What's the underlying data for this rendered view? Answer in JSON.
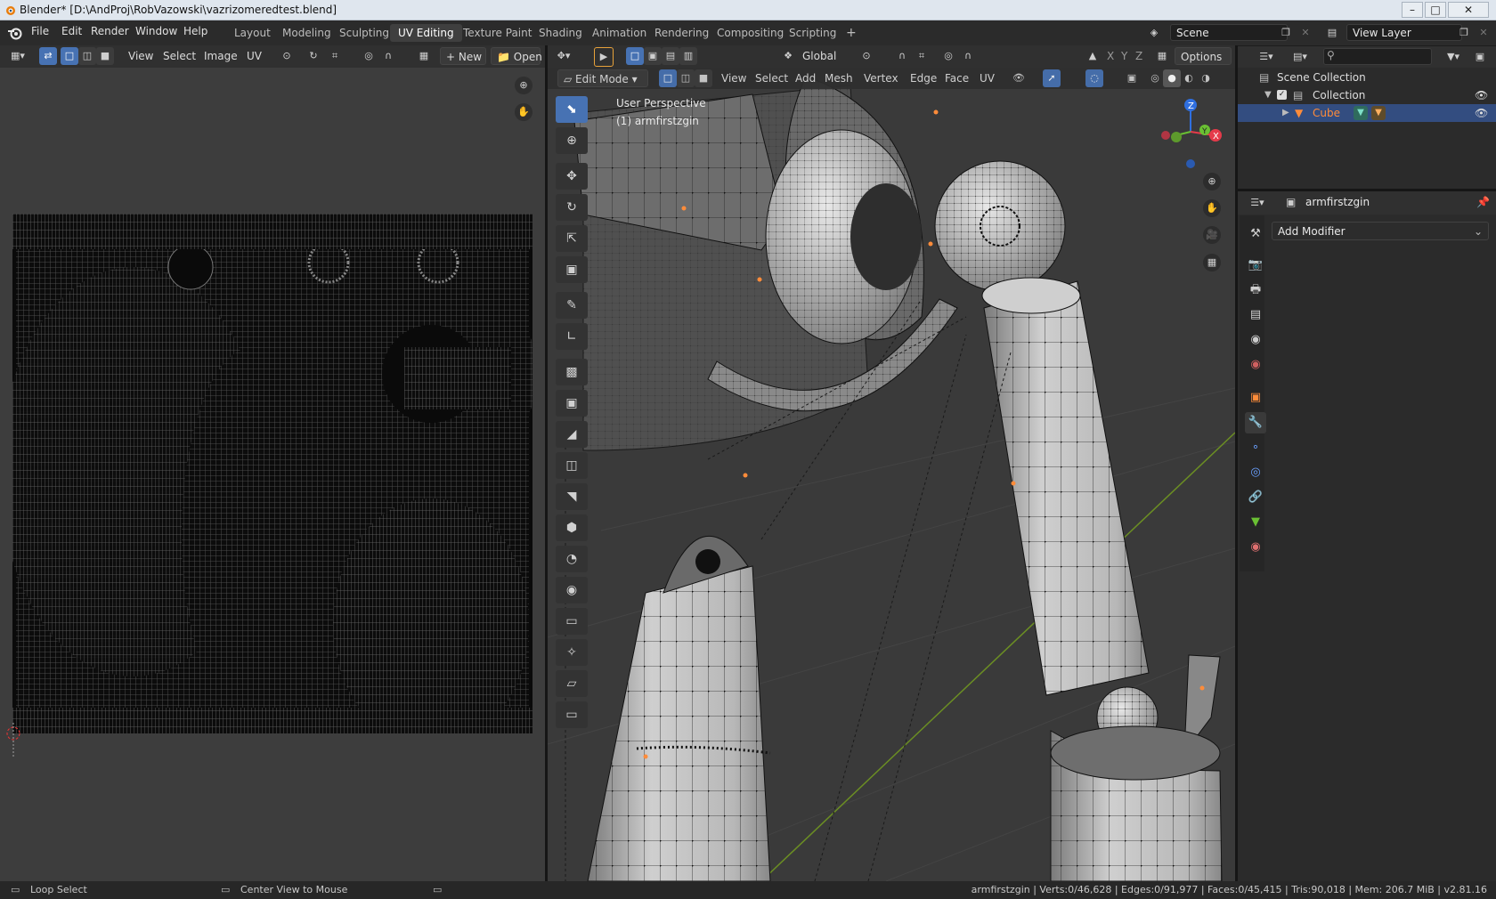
{
  "window": {
    "title": "Blender* [D:\\AndProj\\RobVazowski\\vazrizomeredtest.blend]",
    "controls": [
      "–",
      "□",
      "✕"
    ]
  },
  "topbar": {
    "menus": [
      "File",
      "Edit",
      "Render",
      "Window",
      "Help"
    ],
    "workspaces": [
      "Layout",
      "Modeling",
      "Sculpting",
      "UV Editing",
      "Texture Paint",
      "Shading",
      "Animation",
      "Rendering",
      "Compositing",
      "Scripting"
    ],
    "active_workspace": "UV Editing",
    "add_workspace": "+",
    "scene": "Scene",
    "view_layer": "View Layer"
  },
  "uv_editor": {
    "menus": [
      "View",
      "Select",
      "Image",
      "UV"
    ],
    "new_label": "New",
    "open_label": "Open"
  },
  "viewport": {
    "transform_orientation": "Global",
    "options_label": "Options",
    "mode": "Edit Mode",
    "menus": [
      "View",
      "Select",
      "Add",
      "Mesh",
      "Vertex",
      "Edge",
      "Face",
      "UV"
    ],
    "overlay_title": "User Perspective",
    "overlay_object": "(1) armfirstzgin",
    "gizmo_axes": [
      "X",
      "Y",
      "Z"
    ]
  },
  "outliner": {
    "search_placeholder": "",
    "rows": [
      "Scene Collection",
      "Collection",
      "Cube"
    ]
  },
  "properties": {
    "object_name": "armfirstzgin",
    "add_modifier": "Add Modifier"
  },
  "statusbar": {
    "left1": "Loop Select",
    "left2": "Center View to Mouse",
    "right": "armfirstzgin | Verts:0/46,628 | Edges:0/91,977 | Faces:0/45,415 | Tris:90,018 | Mem: 206.7 MiB | v2.81.16"
  },
  "colors": {
    "accent": "#4772b3",
    "selected_object": "#ff8c3a",
    "selected_row": "#334d80"
  }
}
